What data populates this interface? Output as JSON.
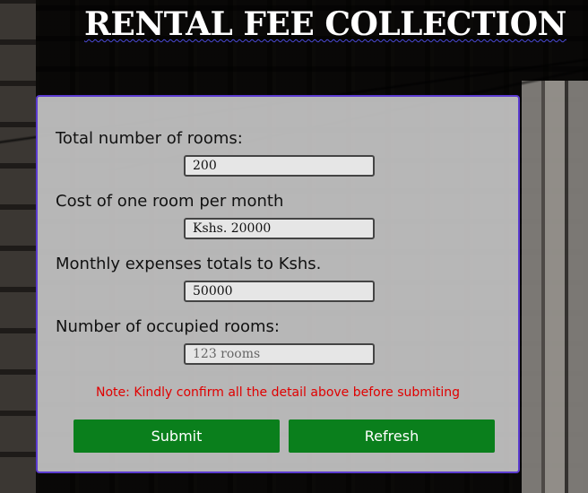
{
  "page": {
    "title": "RENTAL FEE COLLECTION"
  },
  "form": {
    "fields": [
      {
        "label": "Total number of rooms:",
        "value": "200",
        "placeholder": ""
      },
      {
        "label": "Cost of one room per month",
        "value": "Kshs. 20000",
        "placeholder": ""
      },
      {
        "label": "Monthly expenses totals to Kshs.",
        "value": "50000",
        "placeholder": ""
      },
      {
        "label": "Number of occupied rooms:",
        "value": "",
        "placeholder": "123 rooms"
      }
    ],
    "note": "Note: Kindly confirm all the detail above before submiting",
    "submit_label": "Submit",
    "refresh_label": "Refresh"
  },
  "colors": {
    "button": "#0a7f1c",
    "note": "#e00000",
    "panel_border": "#5b3bd0"
  }
}
